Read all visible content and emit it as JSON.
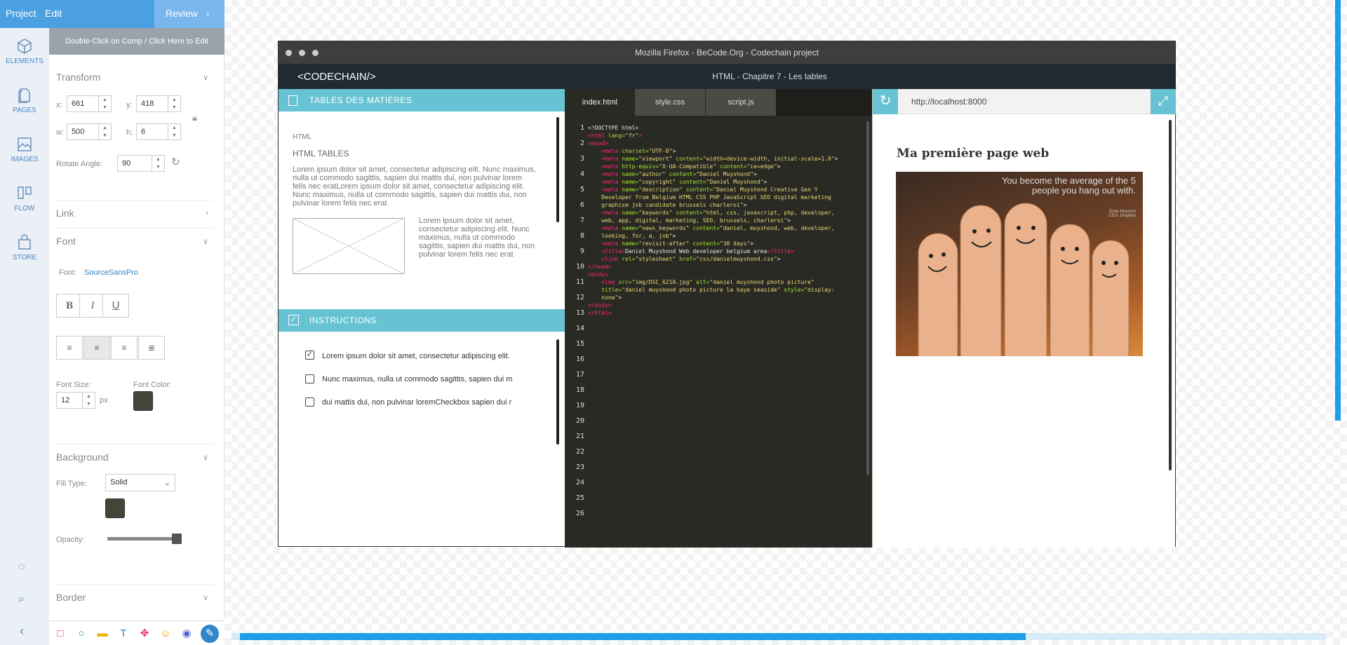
{
  "topbar": {
    "project": "Project",
    "edit": "Edit",
    "review": "Review"
  },
  "rail": [
    {
      "label": "ELEMENTS",
      "icon": "cube-icon"
    },
    {
      "label": "PAGES",
      "icon": "pages-icon"
    },
    {
      "label": "IMAGES",
      "icon": "image-icon"
    },
    {
      "label": "FLOW",
      "icon": "flow-icon"
    },
    {
      "label": "STORE",
      "icon": "store-icon"
    }
  ],
  "props": {
    "banner": "Double-Click on Comp / Click Here to Edit",
    "transform": {
      "title": "Transform",
      "x": "661",
      "y": "418",
      "w": "500",
      "h": "6",
      "rotate_label": "Rotate Angle:",
      "rotate": "90"
    },
    "link": {
      "title": "Link"
    },
    "font": {
      "title": "Font",
      "label": "Font:",
      "value": "SourceSansPro",
      "bold": "B",
      "italic": "I",
      "underline": "U",
      "size_label": "Font Size:",
      "size": "12",
      "unit": "px",
      "color_label": "Font Color:",
      "color": "#434538"
    },
    "background": {
      "title": "Background",
      "fill_label": "Fill Type:",
      "fill": "Solid",
      "color": "#434538",
      "opacity_label": "Opacity:"
    },
    "border": {
      "title": "Border"
    }
  },
  "window": {
    "title": "Mozilla Firefox - BeCode.Org - Codechain project",
    "brand": "<CODECHAIN/>",
    "chapter": "HTML - Chapitre  7 - Les tables"
  },
  "toc": {
    "title": "TABLES DES MATIÈRES",
    "crumb": "HTML",
    "heading": "HTML TABLES",
    "para1": [
      "Lorem ipsum dolor sit amet, consectetur adipiscing elit. Nunc maximus,",
      "nulla ut commodo sagittis, sapien dui mattis dui, non pulvinar lorem",
      "felis nec eratLorem ipsum dolor sit amet, consectetur adipiscing elit.",
      "Nunc maximus, nulla ut commodo sagittis, sapien dui mattis dui, non",
      "pulvinar lorem felis nec erat"
    ],
    "para2": [
      "Lorem ipsum dolor sit amet,",
      "consectetur adipiscing elit. Nunc",
      "maximus, nulla ut commodo",
      "sagittis, sapien dui mattis dui, non",
      "pulvinar lorem felis nec erat"
    ]
  },
  "instructions": {
    "title": "INSTRUCTIONS",
    "items": [
      {
        "text": "Lorem ipsum dolor sit amet, consectetur adipiscing elit.",
        "checked": true
      },
      {
        "text": "Nunc maximus, nulla ut commodo sagittis, sapien dui m",
        "checked": false
      },
      {
        "text": "dui mattis dui, non pulvinar loremCheckbox sapien dui r",
        "checked": false
      }
    ]
  },
  "editor": {
    "tabs": [
      "index.html",
      "style.css",
      "script.js"
    ],
    "line_count": 26
  },
  "preview": {
    "url": "http://localhost:8000",
    "heading": "Ma première page web",
    "quote": [
      "You become the average of the 5",
      "people you hang out with."
    ],
    "author": "Drew Houston",
    "role": "CEO, Dropbox"
  }
}
